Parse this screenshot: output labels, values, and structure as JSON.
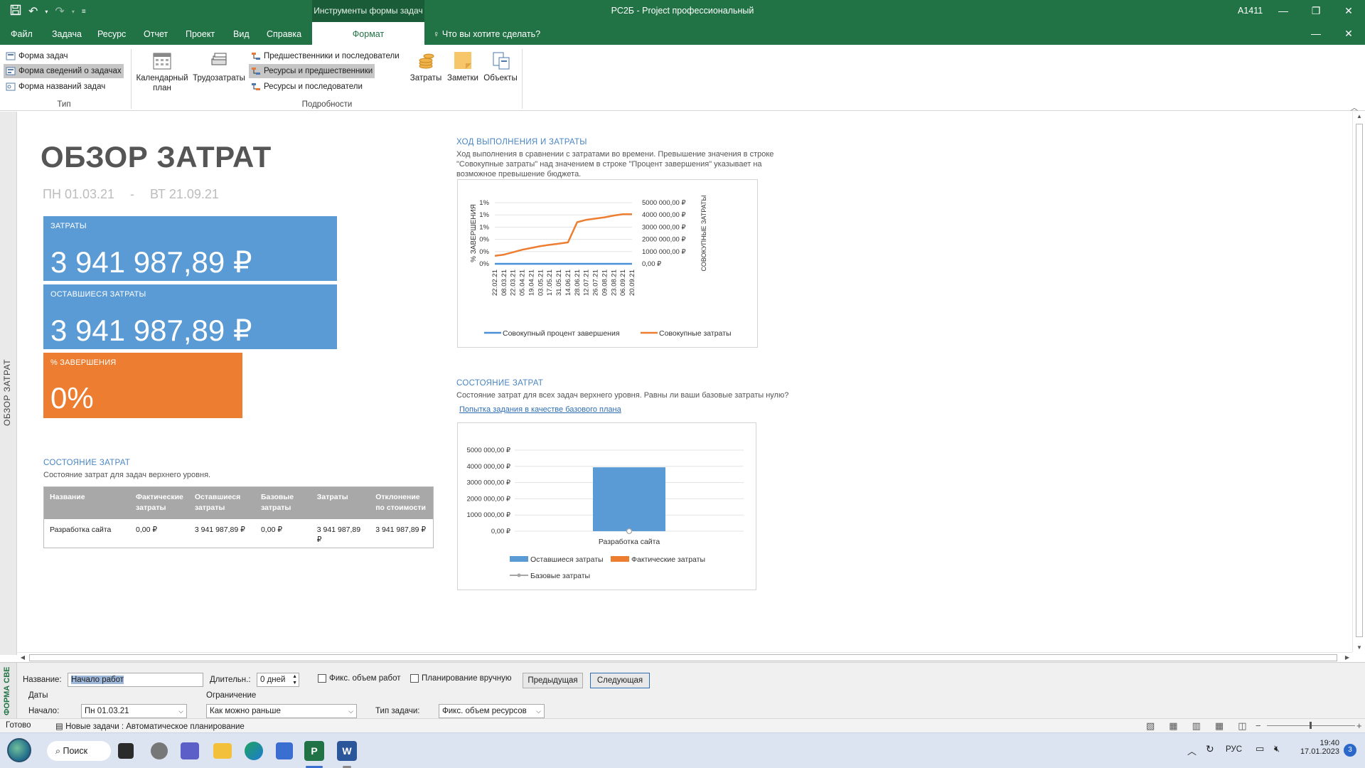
{
  "window": {
    "context_tab": "Инструменты формы задач",
    "title": "РС2Б  -  Project профессиональный",
    "user": "А1411"
  },
  "menu": {
    "tabs": [
      "Файл",
      "Задача",
      "Ресурс",
      "Отчет",
      "Проект",
      "Вид",
      "Справка",
      "Формат"
    ],
    "active_tab": "Формат",
    "tellme": "Что вы хотите сделать?"
  },
  "ribbon": {
    "type_group": {
      "items": [
        "Форма задач",
        "Форма сведений о задачах",
        "Форма названий задач"
      ],
      "selected": "Форма сведений о задачах",
      "label": "Тип"
    },
    "details_group": {
      "calendar_label": "Календарный план",
      "calendar_line1": "Календарный",
      "calendar_line2": "план",
      "work_label": "Трудозатраты",
      "list": [
        "Предшественники и последователи",
        "Ресурсы и предшественники",
        "Ресурсы и последователи"
      ],
      "selected": "Ресурсы и предшественники",
      "costs": "Затраты",
      "notes": "Заметки",
      "objects": "Объекты",
      "label": "Подробности"
    }
  },
  "sidebar_label": "ОБЗОР ЗАТРАТ",
  "report": {
    "title": "ОБЗОР ЗАТРАТ",
    "date_start": "ПН 01.03.21",
    "date_sep": "-",
    "date_end": "ВТ 21.09.21",
    "kpi": {
      "cost_label": "ЗАТРАТЫ",
      "cost_value": "3 941 987,89 ₽",
      "remaining_label": "ОСТАВШИЕСЯ ЗАТРАТЫ",
      "remaining_value": "3 941 987,89 ₽",
      "complete_label": "% ЗАВЕРШЕНИЯ",
      "complete_value": "0%"
    },
    "status_section": {
      "title": "СОСТОЯНИЕ ЗАТРАТ",
      "desc": "Состояние затрат для задач верхнего уровня.",
      "headers": [
        "Название",
        "Фактические затраты",
        "Оставшиеся затраты",
        "Базовые затраты",
        "Затраты",
        "Отклонение по стоимости"
      ],
      "rows": [
        [
          "Разработка сайта",
          "0,00 ₽",
          "3 941 987,89 ₽",
          "0,00 ₽",
          "3 941 987,89 ₽",
          "3 941 987,89 ₽"
        ]
      ]
    },
    "progress_section": {
      "title": "ХОД ВЫПОЛНЕНИЯ И ЗАТРАТЫ",
      "desc_line1": "Ход выполнения в сравнении с затратами во времени. Превышение значения в строке",
      "desc_line2": "\"Совокупные затраты\" над значением в строке \"Процент завершения\" указывает на",
      "desc_line3": "возможное превышение бюджета."
    },
    "cost_status_section": {
      "title": "СОСТОЯНИЕ ЗАТРАТ",
      "desc": "Состояние затрат для всех задач верхнего уровня. Равны ли ваши базовые затраты нулю?",
      "link": "Попытка задания в качестве базового плана"
    }
  },
  "chart_data": [
    {
      "type": "line",
      "title": "",
      "ylabel": "% ЗАВЕРШЕНИЯ",
      "y2label": "СОВОКУПНЫЕ ЗАТРАТЫ",
      "x": [
        "22.02.21",
        "08.03.21",
        "22.03.21",
        "05.04.21",
        "19.04.21",
        "03.05.21",
        "17.05.21",
        "31.05.21",
        "14.06.21",
        "28.06.21",
        "12.07.21",
        "26.07.21",
        "09.08.21",
        "23.08.21",
        "06.09.21",
        "20.09.21"
      ],
      "y_ticks": [
        "0%",
        "0%",
        "0%",
        "1%",
        "1%",
        "1%"
      ],
      "y2_ticks": [
        "0,00 ₽",
        "1000 000,00 ₽",
        "2000 000,00 ₽",
        "3000 000,00 ₽",
        "4000 000,00 ₽",
        "5000 000,00 ₽"
      ],
      "y2lim": [
        0,
        5000000
      ],
      "series": [
        {
          "name": "Совокупный процент завершения",
          "color": "#4a90d9",
          "axis": "left",
          "values": [
            0,
            0,
            0,
            0,
            0,
            0,
            0,
            0,
            0,
            0,
            0,
            0,
            0,
            0,
            0,
            0
          ]
        },
        {
          "name": "Совокупные затраты",
          "color": "#ed7d31",
          "axis": "right",
          "values": [
            650000,
            750000,
            950000,
            1150000,
            1300000,
            1450000,
            1550000,
            1650000,
            1750000,
            3400000,
            3600000,
            3700000,
            3800000,
            3950000,
            4050000,
            4050000
          ]
        }
      ],
      "legend": "bottom"
    },
    {
      "type": "bar",
      "categories": [
        "Разработка сайта"
      ],
      "y_ticks": [
        "0,00 ₽",
        "1000 000,00 ₽",
        "2000 000,00 ₽",
        "3000 000,00 ₽",
        "4000 000,00 ₽",
        "5000 000,00 ₽"
      ],
      "ylim": [
        0,
        5000000
      ],
      "series": [
        {
          "name": "Оставшиеся затраты",
          "color": "#5b9bd5",
          "values": [
            3941987.89
          ]
        },
        {
          "name": "Фактические затраты",
          "color": "#ed7d31",
          "values": [
            0
          ]
        },
        {
          "name": "Базовые затраты",
          "color": "#a5a5a5",
          "values": [
            0
          ]
        }
      ],
      "legend": "bottom"
    }
  ],
  "form": {
    "pane_label": "ФОРМА СВЕ",
    "name_label": "Название:",
    "name_value": "Начало работ",
    "duration_label": "Длительн.:",
    "duration_value": "0 дней",
    "fixed_work": "Фикс. объем работ",
    "manual": "Планирование вручную",
    "prev": "Предыдущая",
    "next": "Следующая",
    "dates_label": "Даты",
    "start_label": "Начало:",
    "start_value": "Пн 01.03.21",
    "constraint_label": "Ограничение",
    "constraint_value": "Как можно раньше",
    "task_type_label": "Тип задачи:",
    "task_type_value": "Фикс. объем ресурсов"
  },
  "status": {
    "ready": "Готово",
    "new_tasks": "Новые задачи : Автоматическое планирование"
  },
  "taskbar": {
    "search": "Поиск",
    "lang": "РУС",
    "time": "19:40",
    "date": "17.01.2023",
    "badge": "3"
  }
}
